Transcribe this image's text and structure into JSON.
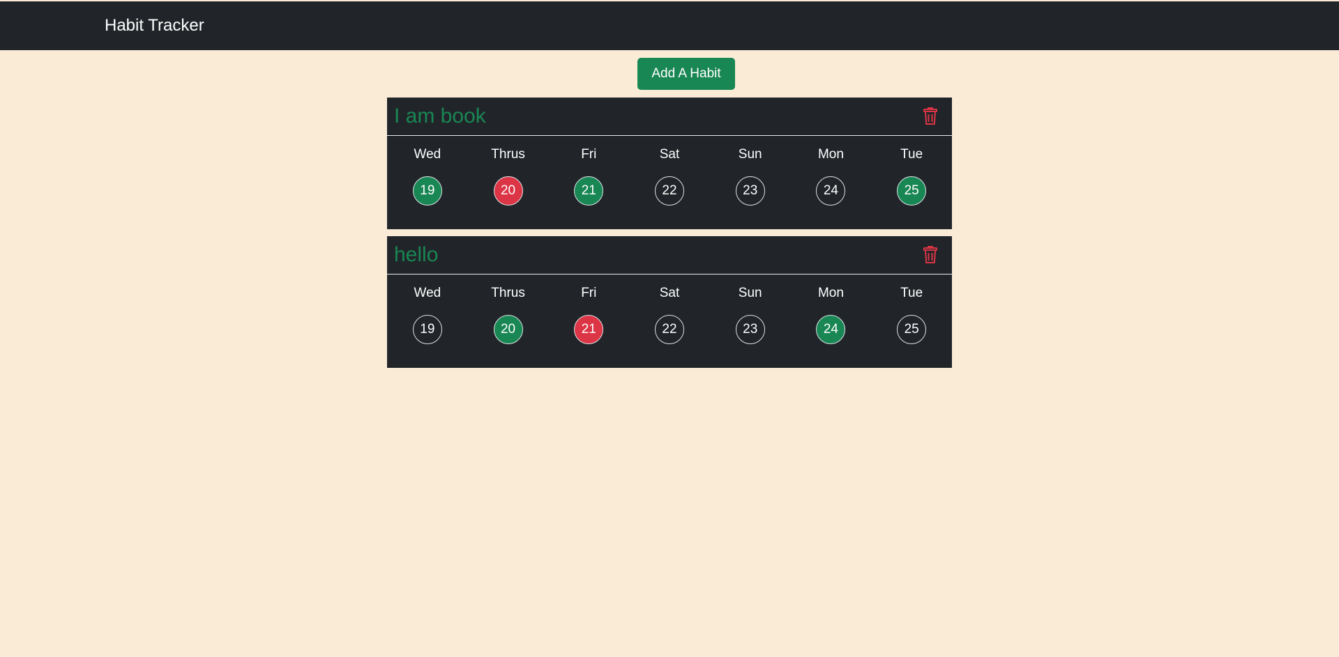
{
  "navbar": {
    "brand": "Habit Tracker"
  },
  "toolbar": {
    "add_label": "Add A Habit"
  },
  "colors": {
    "done": "#198754",
    "missed": "#dc3545",
    "none": "transparent",
    "page_bg": "#faebd7",
    "card_bg": "#212529"
  },
  "habits": [
    {
      "name": "I am book",
      "days": [
        {
          "label": "Wed",
          "date": "19",
          "status": "done"
        },
        {
          "label": "Thrus",
          "date": "20",
          "status": "missed"
        },
        {
          "label": "Fri",
          "date": "21",
          "status": "done"
        },
        {
          "label": "Sat",
          "date": "22",
          "status": "none"
        },
        {
          "label": "Sun",
          "date": "23",
          "status": "none"
        },
        {
          "label": "Mon",
          "date": "24",
          "status": "none"
        },
        {
          "label": "Tue",
          "date": "25",
          "status": "done"
        }
      ]
    },
    {
      "name": "hello",
      "days": [
        {
          "label": "Wed",
          "date": "19",
          "status": "none"
        },
        {
          "label": "Thrus",
          "date": "20",
          "status": "done"
        },
        {
          "label": "Fri",
          "date": "21",
          "status": "missed"
        },
        {
          "label": "Sat",
          "date": "22",
          "status": "none"
        },
        {
          "label": "Sun",
          "date": "23",
          "status": "none"
        },
        {
          "label": "Mon",
          "date": "24",
          "status": "done"
        },
        {
          "label": "Tue",
          "date": "25",
          "status": "none"
        }
      ]
    }
  ]
}
